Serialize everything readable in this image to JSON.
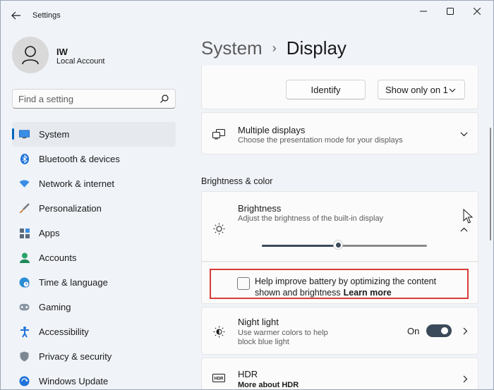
{
  "window": {
    "title": "Settings"
  },
  "profile": {
    "name": "IW",
    "account_type": "Local Account"
  },
  "search": {
    "placeholder": "Find a setting"
  },
  "sidebar": {
    "items": [
      {
        "label": "System",
        "icon": "monitor-icon",
        "active": true
      },
      {
        "label": "Bluetooth & devices",
        "icon": "bluetooth-icon"
      },
      {
        "label": "Network & internet",
        "icon": "wifi-icon"
      },
      {
        "label": "Personalization",
        "icon": "brush-icon"
      },
      {
        "label": "Apps",
        "icon": "apps-icon"
      },
      {
        "label": "Accounts",
        "icon": "person-icon"
      },
      {
        "label": "Time & language",
        "icon": "globe-clock-icon"
      },
      {
        "label": "Gaming",
        "icon": "gamepad-icon"
      },
      {
        "label": "Accessibility",
        "icon": "accessibility-icon"
      },
      {
        "label": "Privacy & security",
        "icon": "shield-icon"
      },
      {
        "label": "Windows Update",
        "icon": "update-icon"
      }
    ]
  },
  "breadcrumb": {
    "parent": "System",
    "separator": "›",
    "current": "Display"
  },
  "identify_card": {
    "identify_label": "Identify",
    "show_only_label": "Show only on 1"
  },
  "multiple_displays": {
    "title": "Multiple displays",
    "subtitle": "Choose the presentation mode for your displays"
  },
  "section": {
    "brightness_color": "Brightness & color"
  },
  "brightness": {
    "title": "Brightness",
    "subtitle": "Adjust the brightness of the built-in display",
    "value": 46
  },
  "battery_option": {
    "line1": "Help improve battery by optimizing the content",
    "line2": "shown and brightness",
    "learn_more": "Learn more",
    "checked": false
  },
  "night_light": {
    "title": "Night light",
    "subtitle_line1": "Use warmer colors to help",
    "subtitle_line2": "block blue light",
    "state_label": "On",
    "on": true
  },
  "hdr": {
    "title": "HDR",
    "link": "More about HDR"
  },
  "colors": {
    "accent": "#0067c0",
    "highlight_border": "#d83b3b",
    "toggle_on": "#3b4a5a"
  }
}
